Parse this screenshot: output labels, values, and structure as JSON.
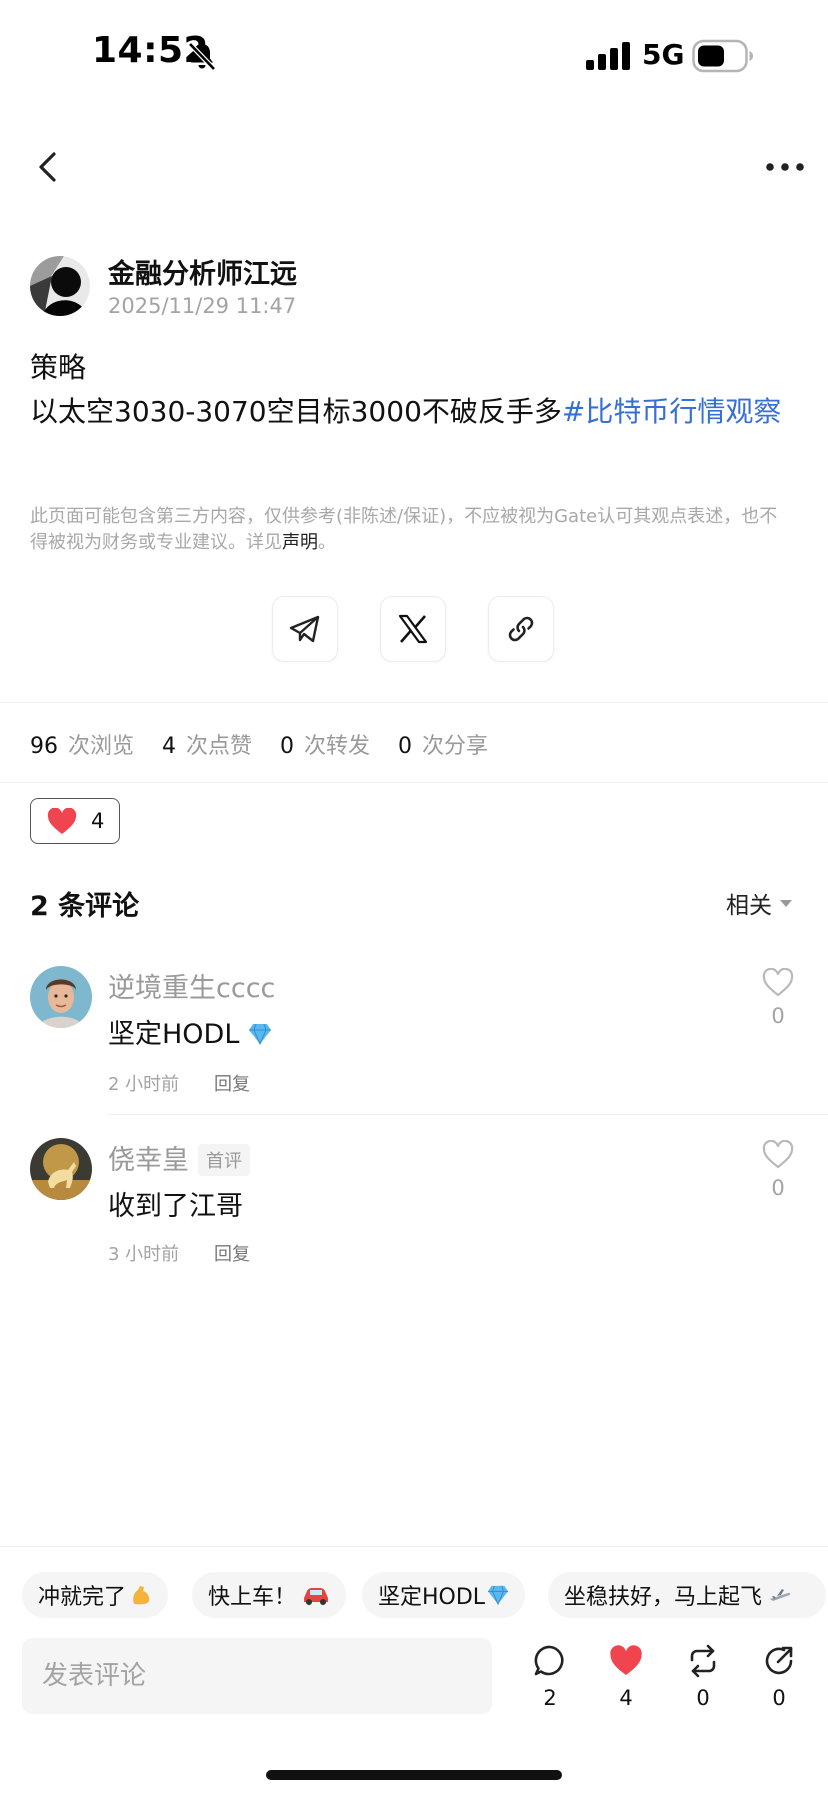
{
  "status_bar": {
    "time": "14:52",
    "network": "5G"
  },
  "post": {
    "author": "金融分析师江远",
    "timestamp": "2025/11/29 11:47",
    "line1": "策略",
    "line2": "以太空3030-3070空目标3000不破反手多",
    "hashtag": "#比特币行情观察",
    "disclaimer": "此页面可能包含第三方内容，仅供参考(非陈述/保证)，不应被视为Gate认可其观点表述，也不得被视为财务或专业建议。详见",
    "disclaimer_link": "声明",
    "disclaimer_end": "。"
  },
  "share_icons": [
    "telegram-icon",
    "x-icon",
    "link-icon"
  ],
  "stats": [
    {
      "num": "96",
      "label": "次浏览"
    },
    {
      "num": "4",
      "label": "次点赞"
    },
    {
      "num": "0",
      "label": "次转发"
    },
    {
      "num": "0",
      "label": "次分享"
    }
  ],
  "reaction": {
    "count": "4"
  },
  "comments_header": {
    "title": "2 条评论",
    "sort": "相关"
  },
  "comments": [
    {
      "name": "逆境重生cccc",
      "text": "坚定HODL",
      "time": "2 小时前",
      "reply": "回复",
      "likes": "0"
    },
    {
      "name": "侥幸皇",
      "badge": "首评",
      "text": "收到了江哥",
      "time": "3 小时前",
      "reply": "回复",
      "likes": "0"
    }
  ],
  "quick_replies": [
    "冲就完了",
    "快上车！",
    "坚定HODL",
    "坐稳扶好，马上起飞"
  ],
  "composer": {
    "placeholder": "发表评论"
  },
  "actions": {
    "comments": "2",
    "likes": "4",
    "reposts": "0",
    "shares": "0"
  },
  "colors": {
    "hashtag": "#3670d6",
    "heart": "#f0444f",
    "muted": "#a3a3a3"
  }
}
